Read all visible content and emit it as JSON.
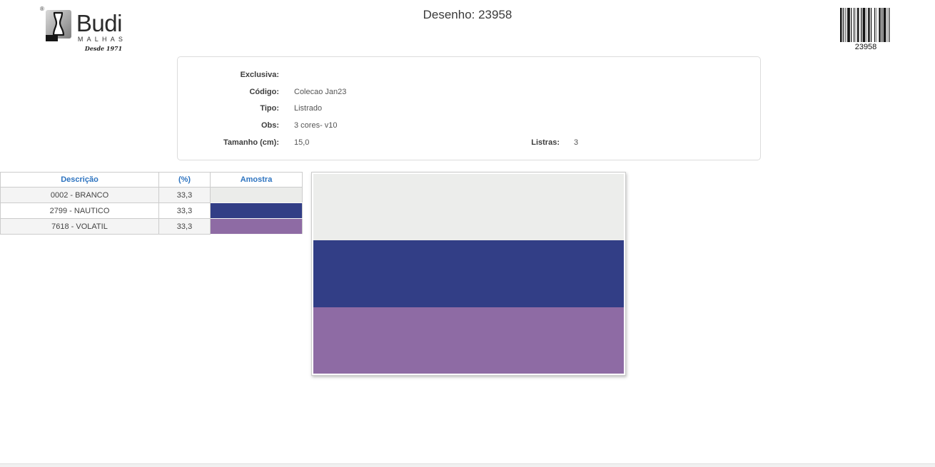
{
  "brand": {
    "registered": "®",
    "name": "Budi",
    "subtitle": "MALHAS",
    "since": "Desde 1971"
  },
  "header": {
    "title": "Desenho: 23958"
  },
  "barcode": {
    "value": "23958"
  },
  "info": {
    "fields": [
      {
        "label": "Exclusiva:",
        "value": ""
      },
      {
        "label": "Código:",
        "value": "Colecao Jan23"
      },
      {
        "label": "Tipo:",
        "value": "Listrado"
      },
      {
        "label": "Obs:",
        "value": "3 cores- v10"
      },
      {
        "label": "Tamanho (cm):",
        "value": "15,0"
      }
    ],
    "listras": {
      "label": "Listras:",
      "value": "3"
    }
  },
  "table": {
    "headers": [
      "Descrição",
      "(%)",
      "Amostra"
    ],
    "rows": [
      {
        "descricao": "0002 - BRANCO",
        "percent": "33,3",
        "swatch_color": "#ebecea"
      },
      {
        "descricao": "2799 - NAUTICO",
        "percent": "33,3",
        "swatch_color": "#323e86"
      },
      {
        "descricao": "7618 - VOLATIL",
        "percent": "33,3",
        "swatch_color": "#8e6ba4"
      }
    ]
  },
  "preview": {
    "stripe_colors": [
      "#ecedeb",
      "#323e86",
      "#8e6ba4"
    ]
  },
  "colors": {
    "table_header_text": "#2e74c0",
    "border_light": "#cccccc"
  }
}
